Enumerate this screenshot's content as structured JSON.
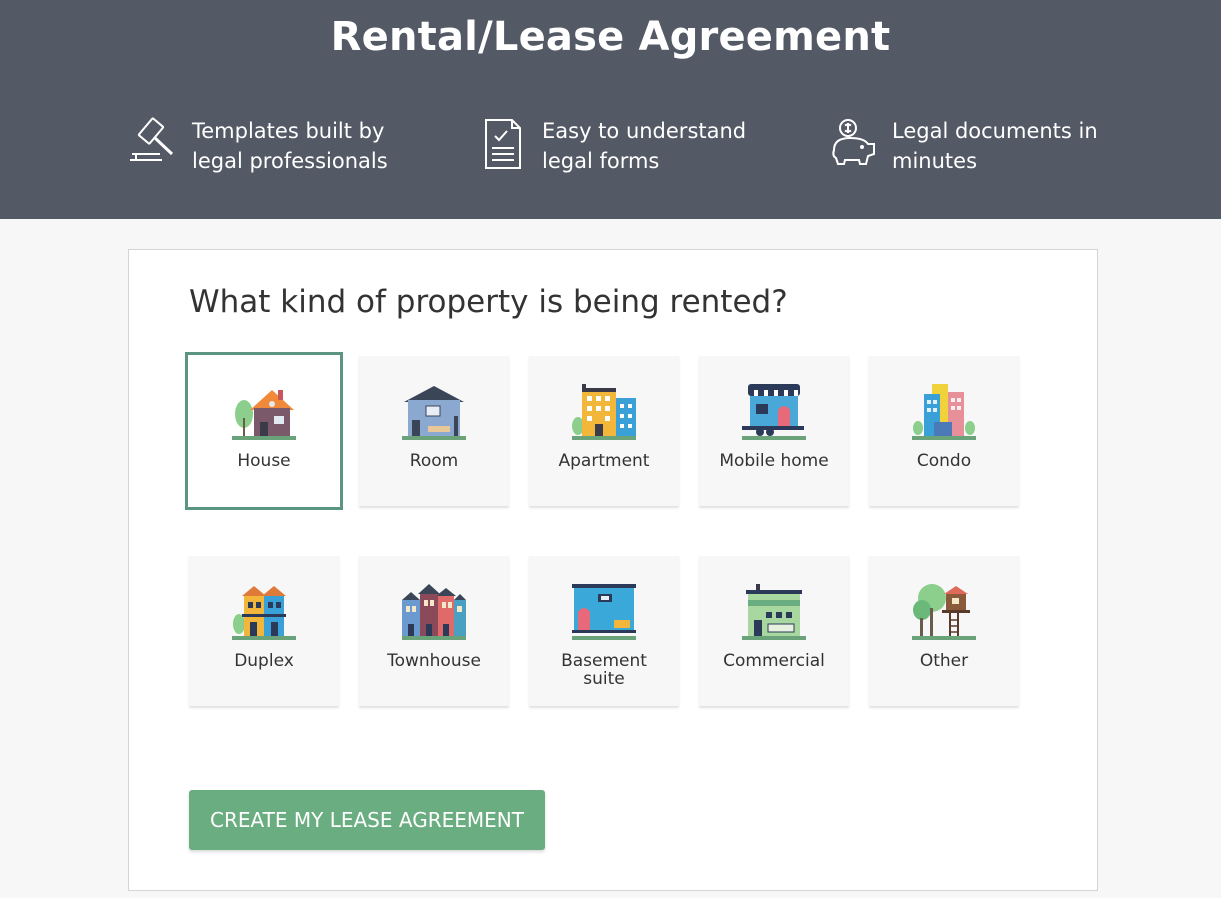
{
  "hero": {
    "title": "Rental/Lease Agreement",
    "features": [
      {
        "icon": "gavel-icon",
        "line1": "Templates built by",
        "line2": "legal professionals"
      },
      {
        "icon": "document-checklist-icon",
        "line1": "Easy to understand",
        "line2": "legal forms"
      },
      {
        "icon": "piggy-bank-icon",
        "line1": "Legal documents in",
        "line2": "minutes"
      }
    ]
  },
  "form": {
    "question": "What kind of property is being rented?",
    "selected": "House",
    "options": [
      {
        "label": "House"
      },
      {
        "label": "Room"
      },
      {
        "label": "Apartment"
      },
      {
        "label": "Mobile home"
      },
      {
        "label": "Condo"
      },
      {
        "label": "Duplex"
      },
      {
        "label": "Townhouse"
      },
      {
        "label": "Basement suite"
      },
      {
        "label": "Commercial"
      },
      {
        "label": "Other"
      }
    ],
    "cta_label": "CREATE MY LEASE AGREEMENT"
  },
  "colors": {
    "header_bg": "#545966",
    "selected_border": "#5c9484",
    "cta_bg": "#6aad80"
  }
}
